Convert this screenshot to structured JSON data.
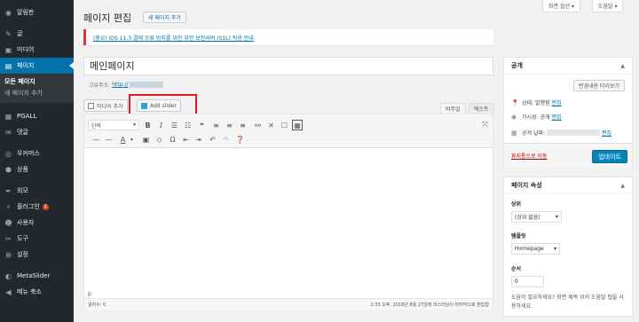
{
  "sidebar": {
    "items": [
      {
        "label": "알림판",
        "icon": "dashboard-icon",
        "glyph": "◉"
      },
      {
        "label": "글",
        "icon": "pin-icon",
        "glyph": "✎"
      },
      {
        "label": "미디어",
        "icon": "media-icon",
        "glyph": "▣"
      },
      {
        "label": "페이지",
        "icon": "page-icon",
        "glyph": "▤"
      }
    ],
    "submenu": [
      {
        "label": "모든 페이지"
      },
      {
        "label": "새 페이지 추가"
      }
    ],
    "items2": [
      {
        "label": "PGALL",
        "icon": "pgall-icon",
        "glyph": "▦"
      },
      {
        "label": "댓글",
        "icon": "comments-icon",
        "glyph": "✉"
      }
    ],
    "items3": [
      {
        "label": "우커머스",
        "icon": "woocommerce-icon",
        "glyph": "◎"
      },
      {
        "label": "상품",
        "icon": "products-icon",
        "glyph": "⬢"
      }
    ],
    "items4": [
      {
        "label": "외모",
        "icon": "appearance-icon",
        "glyph": "✒"
      },
      {
        "label": "플러그인",
        "icon": "plugins-icon",
        "glyph": "⚡",
        "badge": "1"
      },
      {
        "label": "사용자",
        "icon": "users-icon",
        "glyph": "☻"
      },
      {
        "label": "도구",
        "icon": "tools-icon",
        "glyph": "✂"
      },
      {
        "label": "설정",
        "icon": "settings-icon",
        "glyph": "⊞"
      }
    ],
    "items5": [
      {
        "label": "MetaSlider",
        "icon": "metaslider-icon",
        "glyph": "◐"
      },
      {
        "label": "메뉴 축소",
        "icon": "collapse-icon",
        "glyph": "◀"
      }
    ]
  },
  "top": {
    "screen_options": "화면 옵션 ▾",
    "help": "도움말 ▾"
  },
  "header": {
    "title": "페이지 편집",
    "add_new": "새 페이지 추가"
  },
  "notice": {
    "text": "(중요) iOS 11.3 결제 오류 방지를 위한 위한 보안서버 (SSL) 적용 안내"
  },
  "editor": {
    "title_value": "메인페이지",
    "permalink_label": "고유주소:",
    "permalink_url": "http://",
    "add_media": "미디어 추가",
    "add_slider": "Add slider",
    "tab_visual": "비주얼",
    "tab_text": "텍스트",
    "format": "단락",
    "path": "p",
    "word_count": "글자수: 0",
    "last_edited": "2:33 오후, 2018년 8월 27일에 마스터님이 마지막으로 편집함"
  },
  "publish": {
    "title": "공개",
    "preview": "변경내용 미리보기",
    "status_label": "상태:",
    "status_value": "발행됨",
    "edit": "편집",
    "visibility_label": "가시성:",
    "visibility_value": "공개",
    "date_label": "공개 날짜:",
    "trash": "휴지통으로 이동",
    "update": "업데이트"
  },
  "attributes": {
    "title": "페이지 속성",
    "parent_label": "상위",
    "parent_value": "(상위 없음)",
    "template_label": "템플릿",
    "template_value": "Homepage",
    "order_label": "순서",
    "order_value": "0",
    "help": "도움이 필요하세요? 화면 제목 위의 도움말 탭을 사용하세요."
  }
}
